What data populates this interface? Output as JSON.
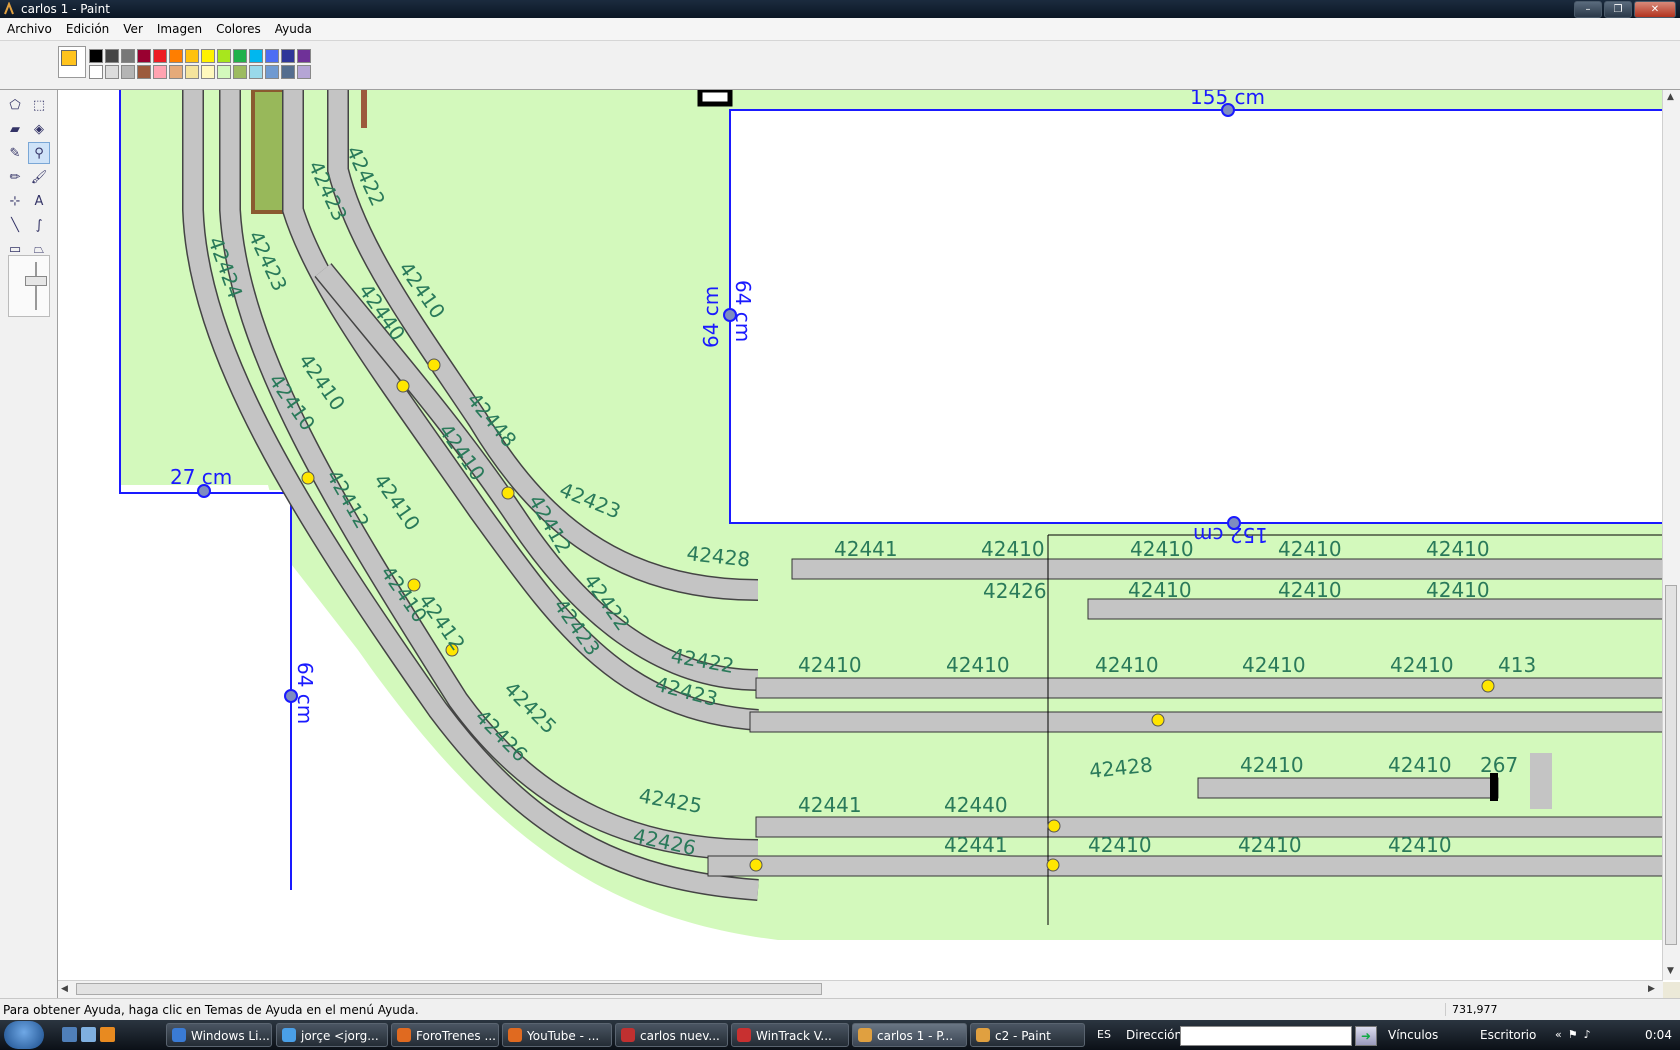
{
  "window": {
    "title": "carlos 1 - Paint",
    "controls": {
      "minimize": "–",
      "maximize": "❐",
      "close": "✕"
    }
  },
  "menu": [
    "Archivo",
    "Edición",
    "Ver",
    "Imagen",
    "Colores",
    "Ayuda"
  ],
  "palette": {
    "foreground": "#ffc31d",
    "background": "#ffffff",
    "row1": [
      "#000000",
      "#464646",
      "#787878",
      "#990030",
      "#ed1c24",
      "#ff7e00",
      "#ffc20e",
      "#fff200",
      "#a8e61d",
      "#22b14c",
      "#00b7ef",
      "#4d6df3",
      "#2f3699",
      "#6f3198"
    ],
    "row2": [
      "#ffffff",
      "#dcdcdc",
      "#b4b4b4",
      "#9c5a3c",
      "#ffa3b1",
      "#e5aa7a",
      "#f5e49c",
      "#fff9bd",
      "#d3f9bc",
      "#9dbb61",
      "#99d9ea",
      "#709ad1",
      "#546d8e",
      "#b5a5d5"
    ]
  },
  "tools": [
    {
      "name": "free-select-icon",
      "glyph": "⬠"
    },
    {
      "name": "rect-select-icon",
      "glyph": "⬚"
    },
    {
      "name": "eraser-icon",
      "glyph": "▰"
    },
    {
      "name": "fill-icon",
      "glyph": "◈"
    },
    {
      "name": "color-picker-icon",
      "glyph": "✎"
    },
    {
      "name": "magnifier-icon",
      "glyph": "⚲"
    },
    {
      "name": "pencil-icon",
      "glyph": "✏"
    },
    {
      "name": "brush-icon",
      "glyph": "🖌"
    },
    {
      "name": "airbrush-icon",
      "glyph": "⊹"
    },
    {
      "name": "text-icon",
      "glyph": "A"
    },
    {
      "name": "line-icon",
      "glyph": "╲"
    },
    {
      "name": "curve-icon",
      "glyph": "∫"
    },
    {
      "name": "rectangle-icon",
      "glyph": "▭"
    },
    {
      "name": "polygon-icon",
      "glyph": "⏢"
    },
    {
      "name": "ellipse-icon",
      "glyph": "⬭"
    },
    {
      "name": "rounded-rect-icon",
      "glyph": "▢"
    }
  ],
  "status": {
    "help": "Para obtener Ayuda, haga clic en Temas de Ayuda en el menú Ayuda.",
    "coords": "731,977"
  },
  "drawing": {
    "dimensions": [
      "155 cm",
      "64 cm",
      "64 cm",
      "152 cm",
      "27 cm",
      "64 cm"
    ],
    "track_labels_upper": [
      "42441",
      "42410",
      "42410",
      "42410",
      "42410",
      "42428",
      "42410",
      "42410",
      "42410",
      "42426"
    ],
    "track_labels_middle": [
      "42410",
      "42410",
      "42410",
      "42410",
      "42410",
      "413",
      "42422",
      "42423"
    ],
    "track_labels_lower": [
      "42441",
      "42440",
      "42428",
      "42410",
      "42410",
      "267",
      "42410",
      "42410",
      "42410",
      "42441",
      "42425",
      "42426"
    ],
    "curve_labels": [
      "42422",
      "42423",
      "42424",
      "42423",
      "42410",
      "42440",
      "42410",
      "42410",
      "42448",
      "42410",
      "42423",
      "42412",
      "42410",
      "42412",
      "42422",
      "42423",
      "42410",
      "42412",
      "42425",
      "42426"
    ]
  },
  "taskbar": {
    "buttons": [
      "Windows Li...",
      "jorçe <jorg...",
      "ForoTrenes ...",
      "YouTube - ...",
      "carlos nuev...",
      "WinTrack  V...",
      "carlos 1 - P...",
      "c2 - Paint"
    ],
    "active": "carlos 1 - P...",
    "lang": "ES",
    "address_label": "Dirección",
    "links": "Vínculos",
    "desktop": "Escritorio",
    "clock": "0:04"
  }
}
